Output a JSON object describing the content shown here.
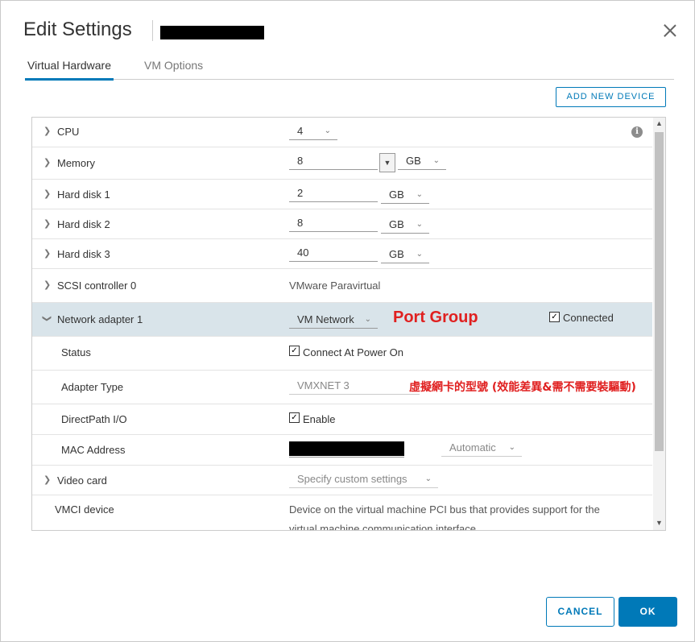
{
  "dialog": {
    "title": "Edit Settings"
  },
  "tabs": [
    {
      "label": "Virtual Hardware"
    },
    {
      "label": "VM Options"
    }
  ],
  "toolbar": {
    "add_device_label": "ADD NEW DEVICE"
  },
  "hardware": {
    "cpu": {
      "label": "CPU",
      "value": "4"
    },
    "memory": {
      "label": "Memory",
      "value": "8",
      "unit": "GB"
    },
    "disk1": {
      "label": "Hard disk 1",
      "value": "2",
      "unit": "GB"
    },
    "disk2": {
      "label": "Hard disk 2",
      "value": "8",
      "unit": "GB"
    },
    "disk3": {
      "label": "Hard disk 3",
      "value": "40",
      "unit": "GB"
    },
    "scsi": {
      "label": "SCSI controller 0",
      "value": "VMware Paravirtual"
    },
    "net": {
      "label": "Network adapter 1",
      "network": "VM Network",
      "connected_label": "Connected",
      "status_label": "Status",
      "connect_power_on_label": "Connect At Power On",
      "adapter_type_label": "Adapter Type",
      "adapter_type_value": "VMXNET 3",
      "directpath_label": "DirectPath I/O",
      "directpath_enable_label": "Enable",
      "mac_label": "MAC Address",
      "mac_mode": "Automatic"
    },
    "video": {
      "label": "Video card",
      "value": "Specify custom settings"
    },
    "vmci": {
      "label": "VMCI device",
      "desc_line1": "Device on the virtual machine PCI bus that provides support for the",
      "desc_line2": "virtual machine communication interface"
    }
  },
  "annotations": {
    "port_group": "Port Group",
    "adapter_note": "虛擬網卡的型號 (效能差異&需不需要裝驅動)"
  },
  "footer": {
    "cancel_label": "CANCEL",
    "ok_label": "OK"
  },
  "icons": {
    "info": "info-icon",
    "close": "close-icon",
    "chevron": "chevron-right-icon"
  },
  "colors": {
    "accent": "#0079b8",
    "annotation": "#e02020",
    "selected_row": "#d9e4ea"
  }
}
